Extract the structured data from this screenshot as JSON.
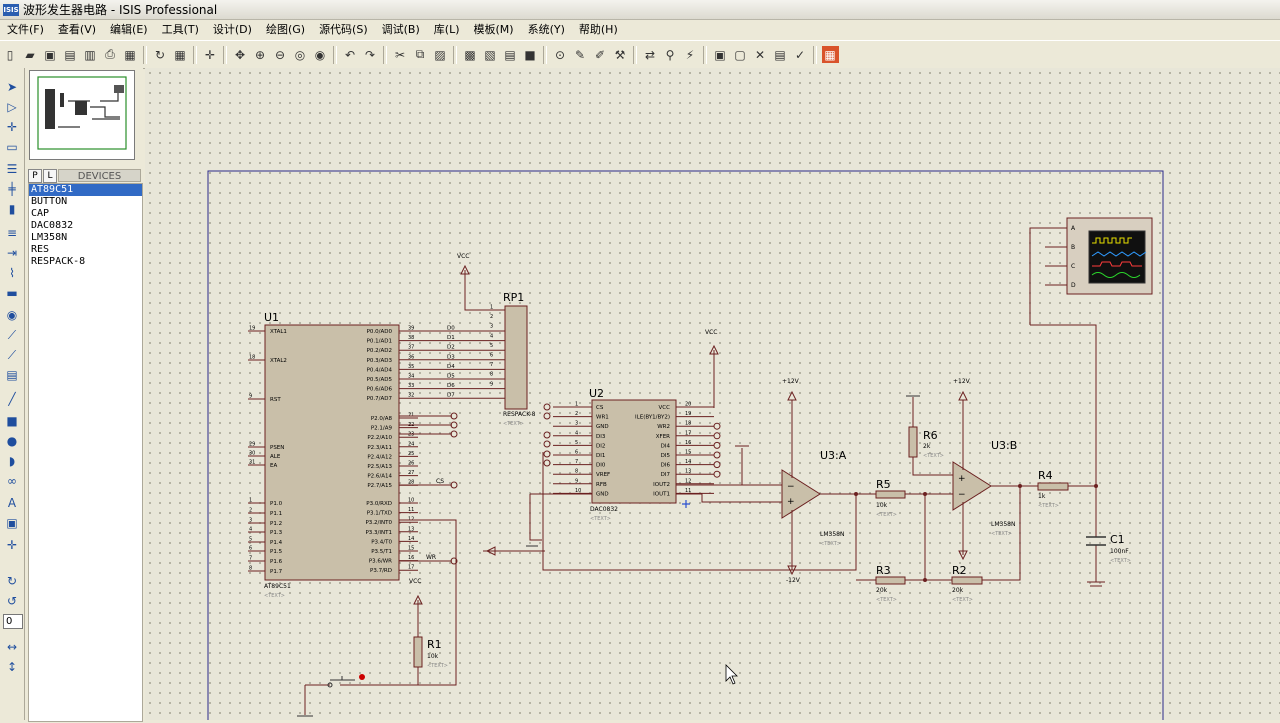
{
  "window": {
    "app_icon_text": "ISIS",
    "title": "波形发生器电路 - ISIS Professional"
  },
  "menu": [
    "文件(F)",
    "查看(V)",
    "编辑(E)",
    "工具(T)",
    "设计(D)",
    "绘图(G)",
    "源代码(S)",
    "调试(B)",
    "库(L)",
    "模板(M)",
    "系统(Y)",
    "帮助(H)"
  ],
  "panel": {
    "tab_p": "P",
    "tab_l": "L",
    "title": "DEVICES",
    "devices": [
      "AT89C51",
      "BUTTON",
      "CAP",
      "DAC0832",
      "LM358N",
      "RES",
      "RESPACK-8"
    ],
    "selected_index": 0,
    "rotation_value": "0"
  },
  "schematic": {
    "u1": {
      "ref": "U1",
      "part": "AT89C51",
      "text": "<TEXT>",
      "left_pins": [
        "XTAL1",
        "XTAL2",
        "RST",
        "PSEN",
        "ALE",
        "EA",
        "P1.0",
        "P1.1",
        "P1.2",
        "P1.3",
        "P1.4",
        "P1.5",
        "P1.6",
        "P1.7"
      ],
      "left_nums": [
        "19",
        "18",
        "9",
        "29",
        "30",
        "31",
        "1",
        "2",
        "3",
        "4",
        "5",
        "6",
        "7",
        "8"
      ],
      "right_pins": [
        "P0.0/AD0",
        "P0.1/AD1",
        "P0.2/AD2",
        "P0.3/AD3",
        "P0.4/AD4",
        "P0.5/AD5",
        "P0.6/AD6",
        "P0.7/AD7",
        "P2.0/A8",
        "P2.1/A9",
        "P2.2/A10",
        "P2.3/A11",
        "P2.4/A12",
        "P2.5/A13",
        "P2.6/A14",
        "P2.7/A15",
        "P3.0/RXD",
        "P3.1/TXD",
        "P3.2/INT0",
        "P3.3/INT1",
        "P3.4/T0",
        "P3.5/T1",
        "P3.6/WR",
        "P3.7/RD"
      ],
      "right_nums": [
        "39",
        "38",
        "37",
        "36",
        "35",
        "34",
        "33",
        "32",
        "21",
        "22",
        "23",
        "24",
        "25",
        "26",
        "27",
        "28",
        "10",
        "11",
        "12",
        "13",
        "14",
        "15",
        "16",
        "17"
      ]
    },
    "bus_labels": [
      "D0",
      "D1",
      "D2",
      "D3",
      "D4",
      "D5",
      "D6",
      "D7"
    ],
    "rp1": {
      "ref": "RP1",
      "part": "RESPACK-8",
      "text": "<TEXT>",
      "pin_nums": [
        "1",
        "2",
        "3",
        "4",
        "5",
        "6",
        "7",
        "8",
        "9"
      ]
    },
    "u2": {
      "ref": "U2",
      "part": "DAC0832",
      "text": "<TEXT>",
      "left_pins": [
        "CS",
        "WR1",
        "GND",
        "DI3",
        "DI2",
        "DI1",
        "DI0",
        "VREF",
        "RFB",
        "GND"
      ],
      "left_nums": [
        "1",
        "2",
        "3",
        "4",
        "5",
        "6",
        "7",
        "8",
        "9",
        "10"
      ],
      "right_pins": [
        "VCC",
        "ILE(BY1/BY2)",
        "WR2",
        "XFER",
        "DI4",
        "DI5",
        "DI6",
        "DI7",
        "IOUT2",
        "IOUT1"
      ],
      "right_nums": [
        "20",
        "19",
        "18",
        "17",
        "16",
        "15",
        "14",
        "13",
        "12",
        "11"
      ]
    },
    "net_labels": {
      "cs": "CS",
      "wr": "WR",
      "vcc": "VCC",
      "p12": "+12V",
      "m12": "-12V",
      "a": "A",
      "b": "B",
      "c": "C",
      "d": "D"
    },
    "u3a": {
      "ref": "U3:A",
      "part": "LM358N",
      "text": "<TEXT>"
    },
    "u3b": {
      "ref": "U3:B",
      "part": "LM358N",
      "text": "<TEXT>"
    },
    "r1": {
      "ref": "R1",
      "value": "10k",
      "text": "<TEXT>"
    },
    "r2": {
      "ref": "R2",
      "value": "20k",
      "text": "<TEXT>"
    },
    "r3": {
      "ref": "R3",
      "value": "20k",
      "text": "<TEXT>"
    },
    "r4": {
      "ref": "R4",
      "value": "1k",
      "text": "<TEXT>"
    },
    "r5": {
      "ref": "R5",
      "value": "10k",
      "text": "<TEXT>"
    },
    "r6": {
      "ref": "R6",
      "value": "2k",
      "text": "<TEXT>"
    },
    "c1": {
      "ref": "C1",
      "value": "100nF",
      "text": "<TEXT>"
    }
  }
}
